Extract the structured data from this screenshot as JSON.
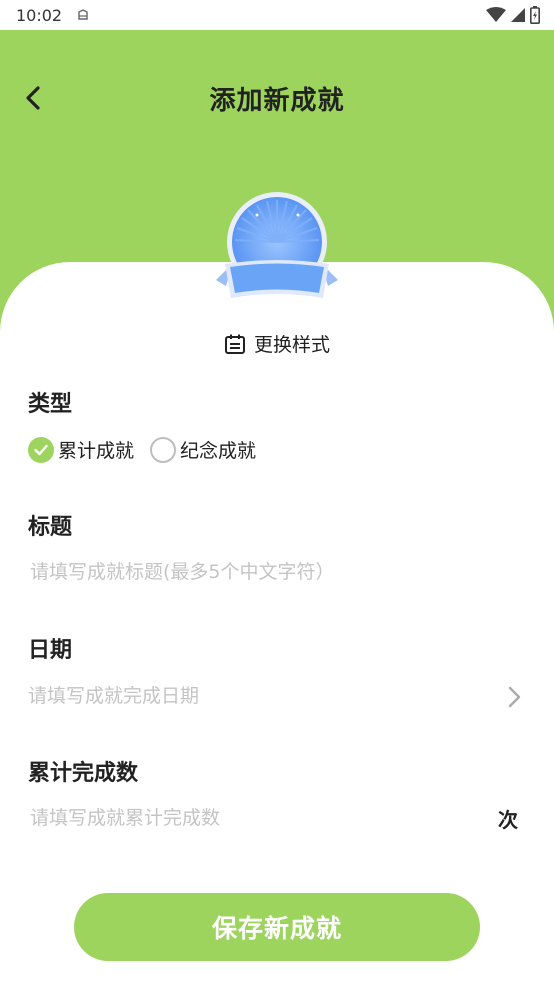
{
  "status_bar": {
    "time": "10:02"
  },
  "header": {
    "title": "添加新成就"
  },
  "style_picker": {
    "label": "更换样式"
  },
  "type_section": {
    "label": "类型",
    "options": [
      {
        "label": "累计成就",
        "selected": true
      },
      {
        "label": "纪念成就",
        "selected": false
      }
    ]
  },
  "title_section": {
    "label": "标题",
    "placeholder": "请填写成就标题(最多5个中文字符）",
    "value": ""
  },
  "date_section": {
    "label": "日期",
    "placeholder": "请填写成就完成日期",
    "value": ""
  },
  "count_section": {
    "label": "累计完成数",
    "placeholder": "请填写成就累计完成数",
    "value": "",
    "unit": "次"
  },
  "save_button": {
    "label": "保存新成就"
  },
  "colors": {
    "accent": "#9dd45e",
    "badge_blue": "#5b9af5",
    "placeholder": "#c4c4c4"
  }
}
